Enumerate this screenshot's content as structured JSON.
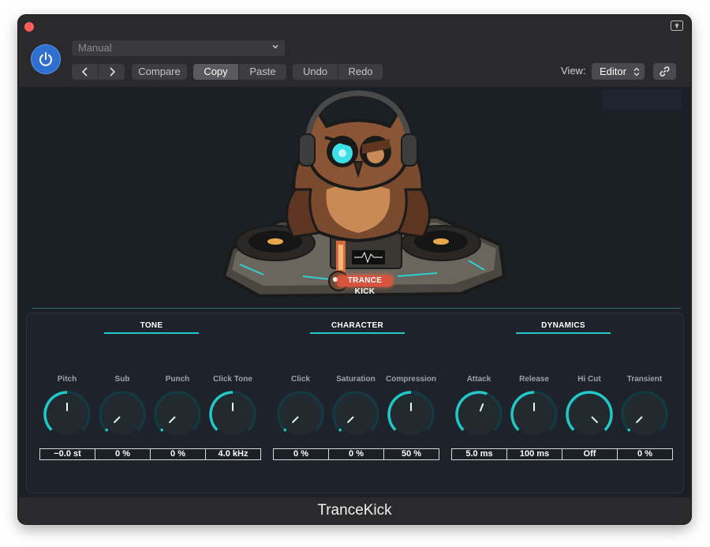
{
  "toolbar": {
    "preset": "Manual",
    "compare": "Compare",
    "copy": "Copy",
    "paste": "Paste",
    "undo": "Undo",
    "redo": "Redo",
    "view_label": "View:",
    "view_value": "Editor"
  },
  "art": {
    "badge": "TRANCE KICK"
  },
  "sections": {
    "tone": "TONE",
    "character": "CHARACTER",
    "dynamics": "DYNAMICS"
  },
  "knobs": [
    {
      "label": "Pitch",
      "value": "−0.0 st",
      "level": 0.5
    },
    {
      "label": "Sub",
      "value": "0 %",
      "level": 0.0
    },
    {
      "label": "Punch",
      "value": "0 %",
      "level": 0.0
    },
    {
      "label": "Click Tone",
      "value": "4.0 kHz",
      "level": 0.5
    },
    {
      "label": "Click",
      "value": "0 %",
      "level": 0.0
    },
    {
      "label": "Saturation",
      "value": "0 %",
      "level": 0.0
    },
    {
      "label": "Compression",
      "value": "50 %",
      "level": 0.5
    },
    {
      "label": "Attack",
      "value": "5.0 ms",
      "level": 0.58
    },
    {
      "label": "Release",
      "value": "100 ms",
      "level": 0.5
    },
    {
      "label": "Hi Cut",
      "value": "Off",
      "level": 1.0
    },
    {
      "label": "Transient",
      "value": "0 %",
      "level": 0.0
    }
  ],
  "colors": {
    "accent": "#22c7c7",
    "track": "#133a40",
    "power": "#2f6fd0"
  },
  "footer": {
    "title": "TranceKick"
  }
}
